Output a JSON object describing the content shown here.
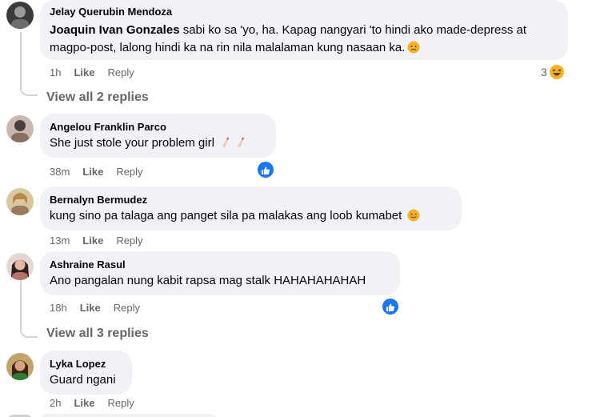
{
  "comments": [
    {
      "author": "Jelay Querubin Mendoza",
      "mention": "Joaquin Ivan Gonzales",
      "line1": "sabi ko sa 'yo, ha. Kapag nangyari 'to hindi ako made-depress at",
      "line2": "magpo-post, lalong hindi ka na rin nila malalaman kung nasaan ka.",
      "time": "1h",
      "like": "Like",
      "reply": "Reply",
      "reaction_count": "3"
    },
    {
      "author": "Angelou Franklin Parco",
      "text": "She just stole your problem girl",
      "time": "38m",
      "like": "Like",
      "reply": "Reply"
    },
    {
      "author": "Bernalyn Bermudez",
      "text": "kung sino pa talaga ang panget sila pa malakas ang loob kumabet",
      "time": "13m",
      "like": "Like",
      "reply": "Reply"
    },
    {
      "author": "Ashraine Rasul",
      "text": "Ano pangalan nung kabit rapsa mag stalk HAHAHAHAHAH",
      "time": "18h",
      "like": "Like",
      "reply": "Reply"
    },
    {
      "author": "Lyka Lopez",
      "text": "Guard ngani",
      "time": "2h",
      "like": "Like",
      "reply": "Reply"
    }
  ],
  "view_replies_1": "View all 2 replies",
  "view_replies_2": "View all 3 replies",
  "icons": {
    "reaction": "haha-emoji-icon",
    "like_badge": "thumbs-up-icon"
  },
  "colors": {
    "bubble": "#f0f2f5",
    "meta": "#65676b",
    "like_blue": "#1877f2",
    "haha_yellow": "#f7b125"
  }
}
